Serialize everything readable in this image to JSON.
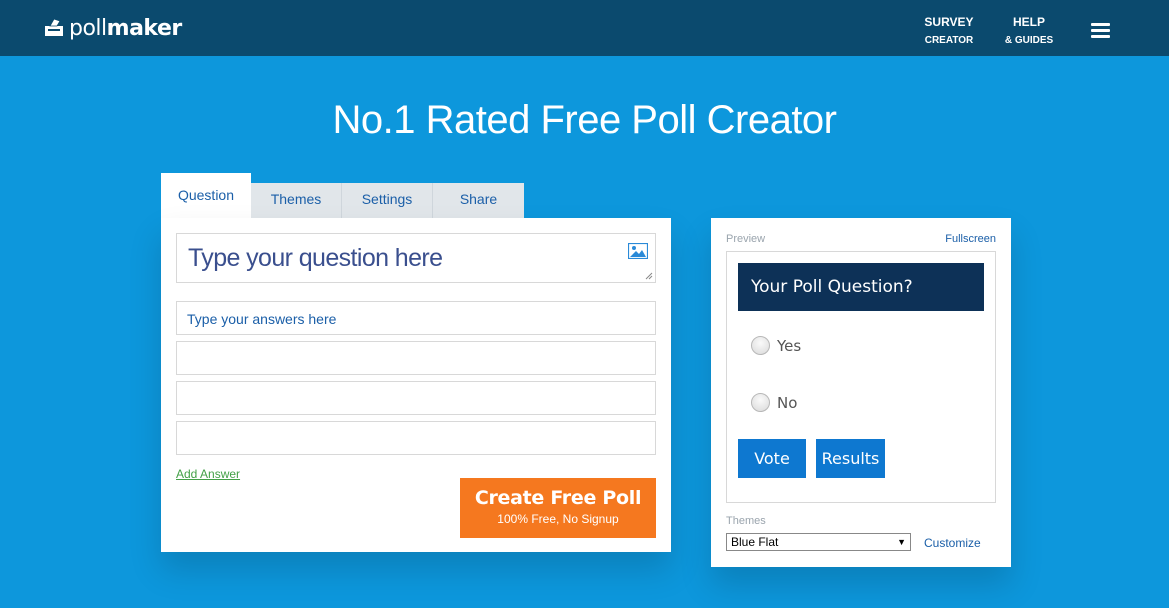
{
  "header": {
    "logo": {
      "text_poll": "poll",
      "text_maker": "maker"
    },
    "nav": [
      {
        "line1": "SURVEY",
        "line2": "CREATOR"
      },
      {
        "line1": "HELP",
        "line2": "& GUIDES"
      }
    ]
  },
  "hero": {
    "title": "No.1 Rated Free Poll Creator"
  },
  "tabs": [
    {
      "label": "Question"
    },
    {
      "label": "Themes"
    },
    {
      "label": "Settings"
    },
    {
      "label": "Share"
    }
  ],
  "editor": {
    "question_placeholder": "Type your question here",
    "answers": [
      {
        "placeholder": "Type your answers here"
      },
      {
        "placeholder": ""
      },
      {
        "placeholder": ""
      },
      {
        "placeholder": ""
      }
    ],
    "add_answer_label": "Add Answer",
    "create_button": {
      "label": "Create Free Poll",
      "sublabel": "100% Free, No Signup"
    }
  },
  "preview": {
    "label": "Preview",
    "fullscreen_label": "Fullscreen",
    "poll_question": "Your Poll Question?",
    "options": [
      "Yes",
      "No"
    ],
    "vote_label": "Vote",
    "results_label": "Results",
    "themes_label": "Themes",
    "theme_selected": "Blue Flat",
    "customize_label": "Customize"
  },
  "colors": {
    "background": "#0d97dc",
    "header": "#0b4a6e",
    "accent_orange": "#f5781f",
    "button_blue": "#0e78d0",
    "poll_header": "#0d3157"
  }
}
